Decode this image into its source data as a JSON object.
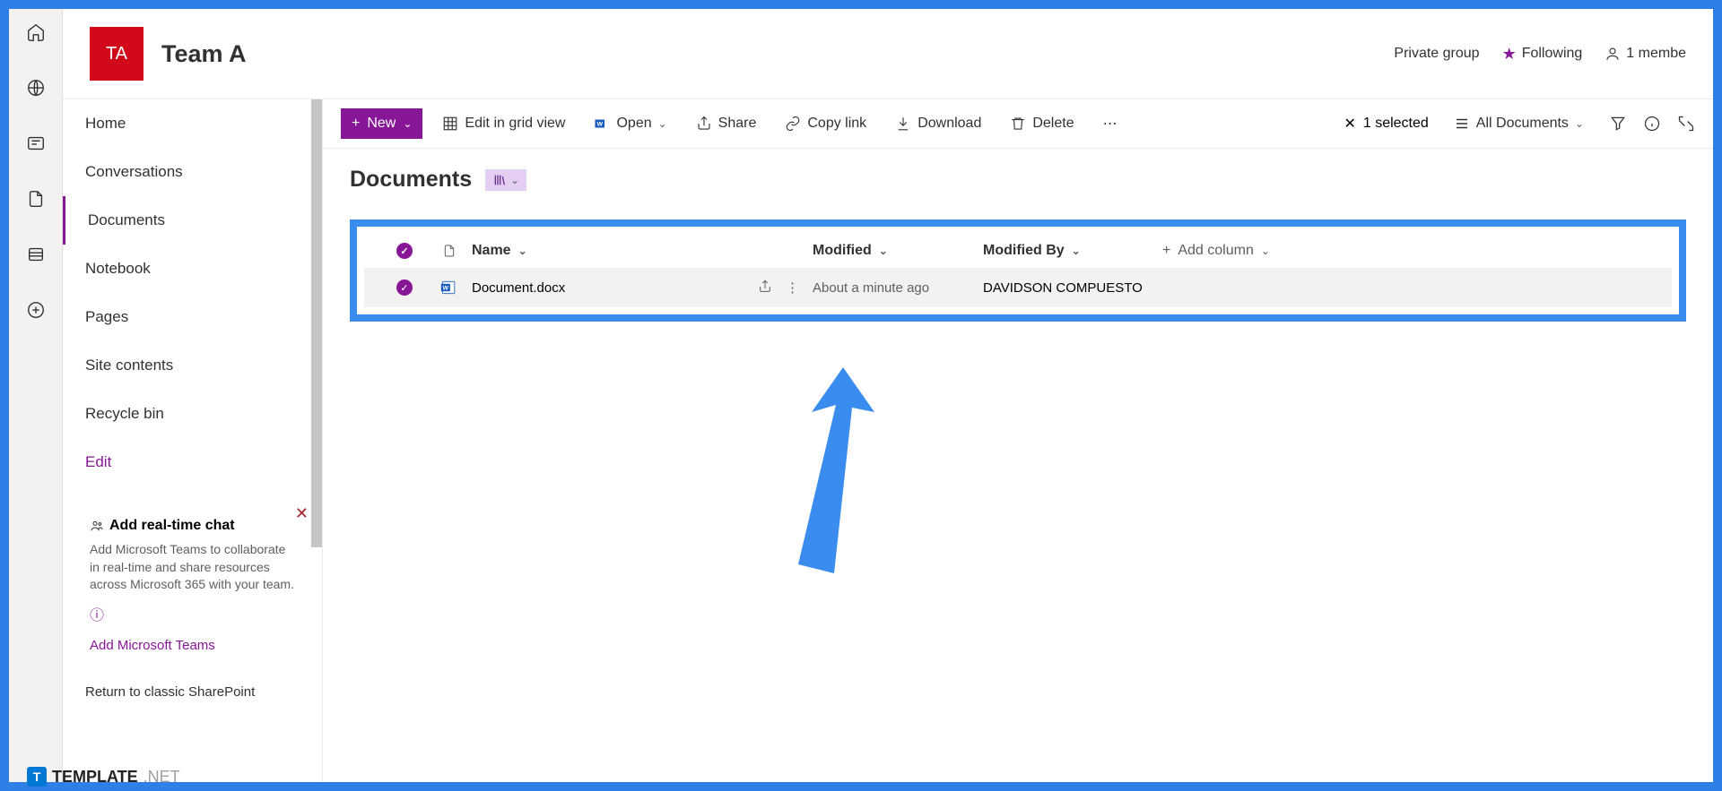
{
  "site": {
    "logoText": "TA",
    "title": "Team A",
    "privacy": "Private group",
    "following": "Following",
    "members": "1 membe"
  },
  "rail": [
    "home",
    "globe",
    "news",
    "file",
    "list",
    "add"
  ],
  "nav": {
    "items": [
      "Home",
      "Conversations",
      "Documents",
      "Notebook",
      "Pages",
      "Site contents",
      "Recycle bin"
    ],
    "edit": "Edit",
    "return": "Return to classic SharePoint"
  },
  "chat": {
    "title": "Add real-time chat",
    "desc": "Add Microsoft Teams to collaborate in real-time and share resources across Microsoft 365 with your team.",
    "link": "Add Microsoft Teams"
  },
  "toolbar": {
    "new": "New",
    "grid": "Edit in grid view",
    "open": "Open",
    "share": "Share",
    "copy": "Copy link",
    "download": "Download",
    "delete": "Delete",
    "selected": "1 selected",
    "allDocs": "All Documents"
  },
  "library": {
    "title": "Documents",
    "columns": {
      "name": "Name",
      "modified": "Modified",
      "modifiedBy": "Modified By",
      "add": "Add column"
    },
    "rows": [
      {
        "name": "Document.docx",
        "modified": "About a minute ago",
        "modifiedBy": "DAVIDSON COMPUESTO"
      }
    ]
  },
  "watermark": {
    "brand": "TEMPLATE",
    "suffix": ".NET"
  }
}
